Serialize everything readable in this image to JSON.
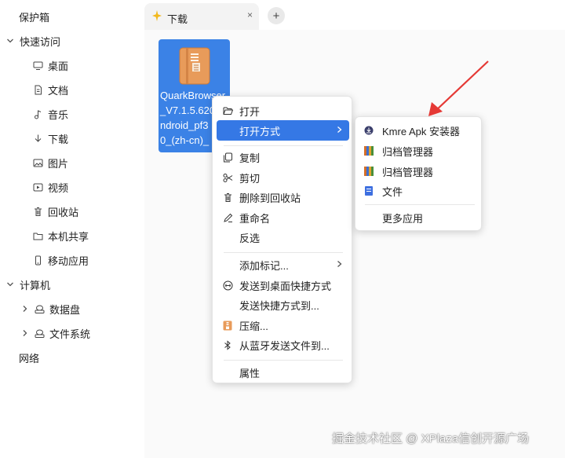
{
  "sidebar": {
    "vault": "保护箱",
    "quick_access": "快速访问",
    "items": [
      {
        "label": "桌面",
        "icon": "desktop-icon"
      },
      {
        "label": "文档",
        "icon": "document-icon"
      },
      {
        "label": "音乐",
        "icon": "music-icon"
      },
      {
        "label": "下载",
        "icon": "download-icon"
      },
      {
        "label": "图片",
        "icon": "picture-icon"
      },
      {
        "label": "视频",
        "icon": "video-icon"
      },
      {
        "label": "回收站",
        "icon": "trash-icon"
      },
      {
        "label": "本机共享",
        "icon": "folder-icon"
      },
      {
        "label": "移动应用",
        "icon": "phone-icon"
      }
    ],
    "computer": "计算机",
    "drives": [
      {
        "label": "数据盘",
        "icon": "drive-icon"
      },
      {
        "label": "文件系统",
        "icon": "drive-icon"
      }
    ],
    "network": "网络"
  },
  "tabs": {
    "active_label": "下载",
    "add_label": "+",
    "close_label": "×"
  },
  "file": {
    "name_lines": "QuarkBrowser\n_V7.1.5.620\nndroid_pf3\n0_(zh-cn)_"
  },
  "context_menu": {
    "open": "打开",
    "open_with": "打开方式",
    "copy": "复制",
    "cut": "剪切",
    "delete": "删除到回收站",
    "rename": "重命名",
    "invert_select": "反选",
    "add_tag": "添加标记...",
    "send_desktop": "发送到桌面快捷方式",
    "send_shortcut": "发送快捷方式到...",
    "compress": "压缩...",
    "bluetooth": "从蓝牙发送文件到...",
    "properties": "属性"
  },
  "submenu": {
    "items": [
      {
        "label": "Kmre Apk 安装器",
        "icon": "kmre-installer-icon"
      },
      {
        "label": "归档管理器",
        "icon": "archive-manager-icon"
      },
      {
        "label": "归档管理器",
        "icon": "archive-manager-icon"
      },
      {
        "label": "文件",
        "icon": "file-manager-icon"
      }
    ],
    "more": "更多应用"
  },
  "watermark": "掘金技术社区 @ XPlaza信创开源广场",
  "colors": {
    "accent": "#3578e5",
    "arrow": "#e53935"
  }
}
